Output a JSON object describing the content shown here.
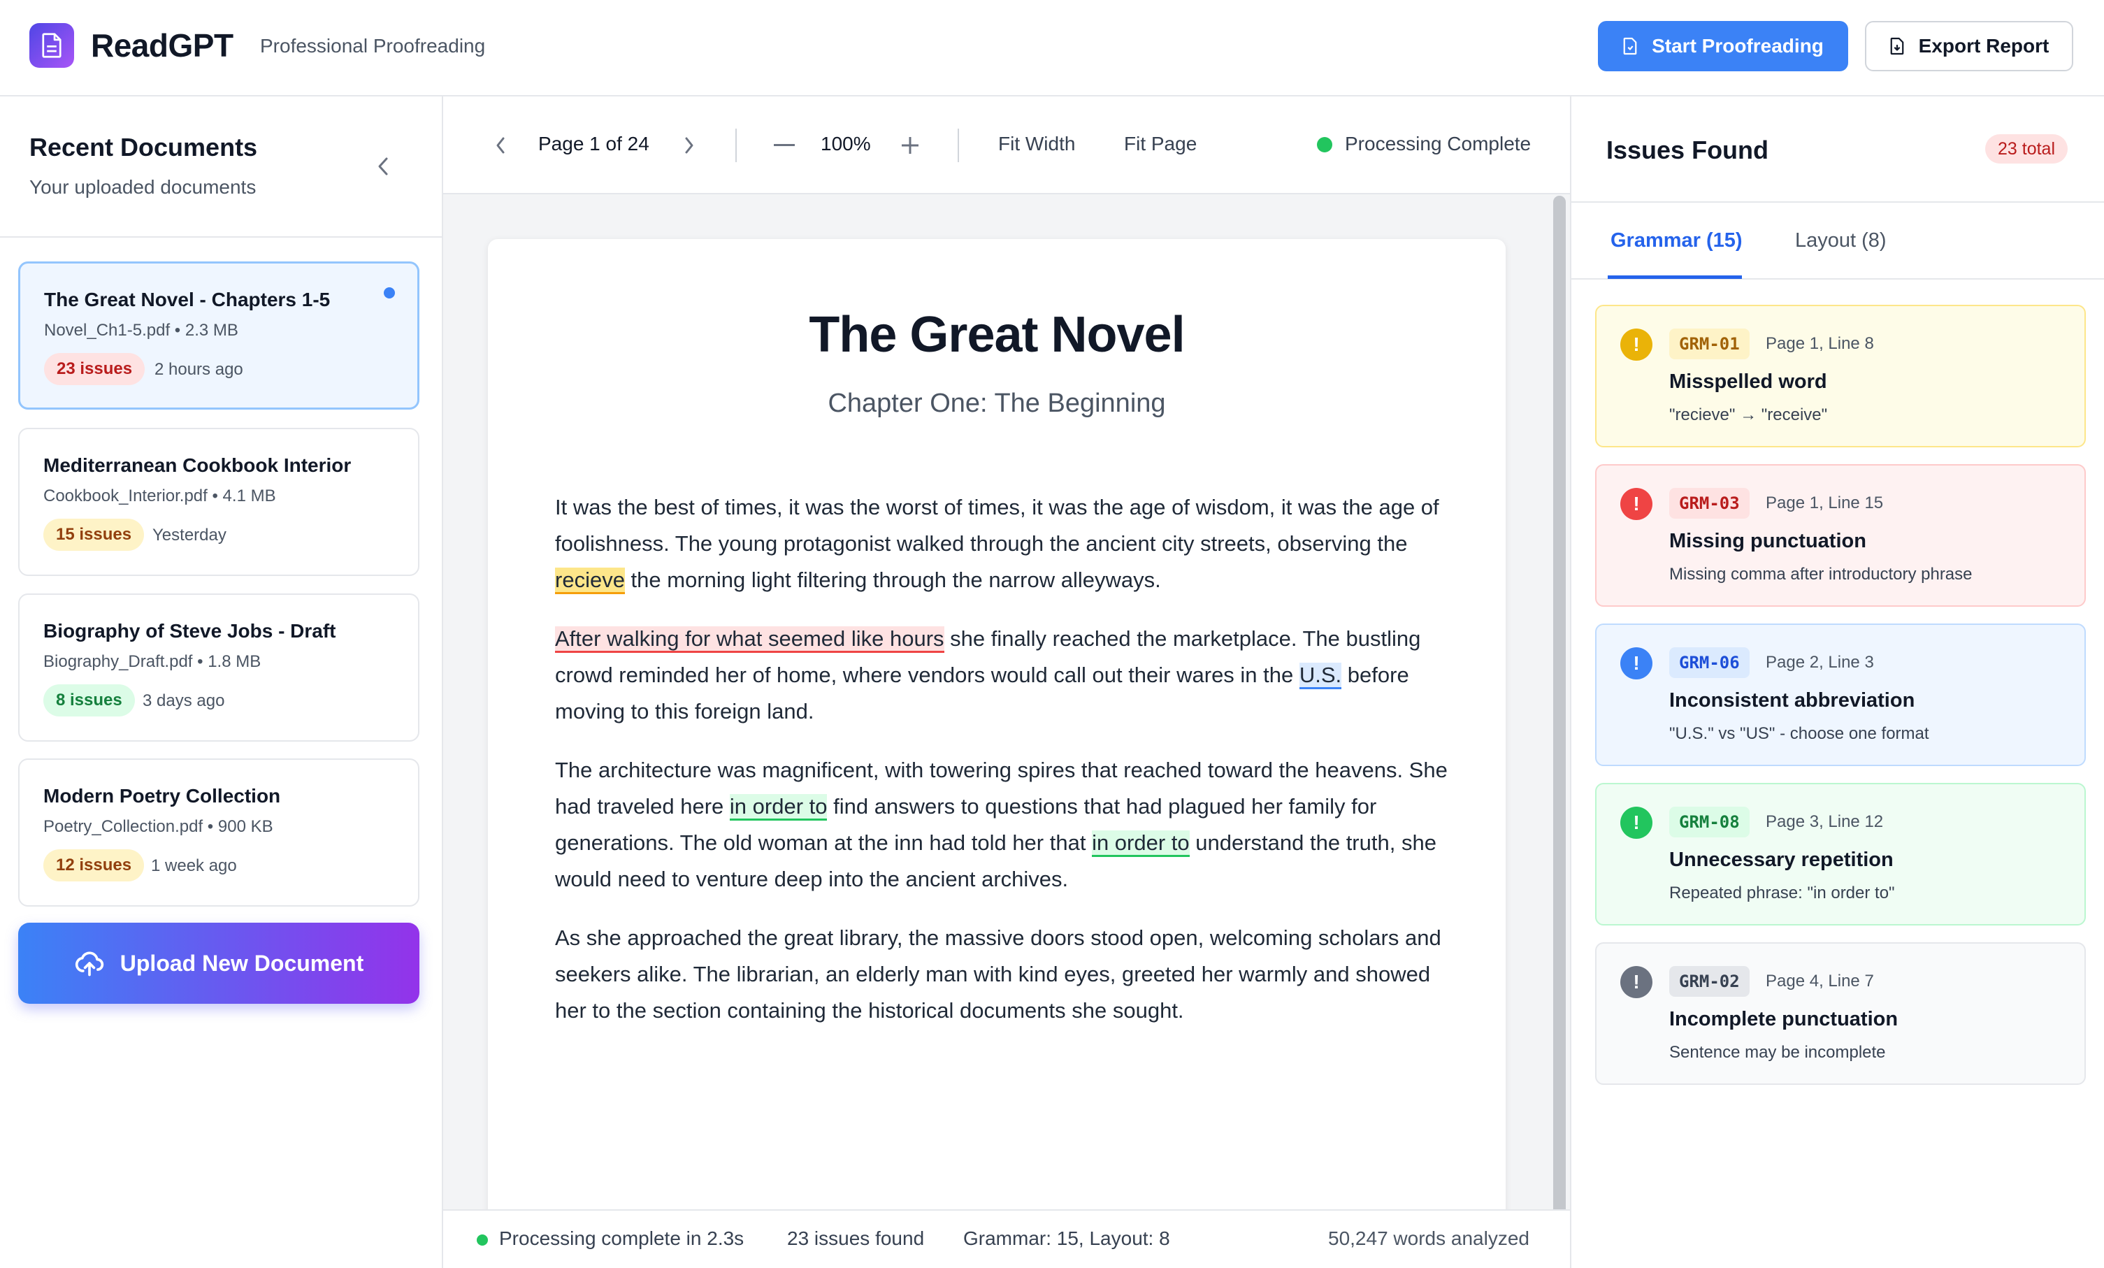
{
  "header": {
    "app_name": "ReadGPT",
    "app_subtitle": "Professional Proofreading",
    "start_button": "Start Proofreading",
    "export_button": "Export Report",
    "brand_gradient": [
      "#4f46e5",
      "#a855f7"
    ],
    "accent": "#3b82f6"
  },
  "sidebar": {
    "title": "Recent Documents",
    "subtitle": "Your uploaded documents",
    "documents": [
      {
        "title": "The Great Novel - Chapters 1-5",
        "meta": "Novel_Ch1-5.pdf • 2.3 MB",
        "issues": "23 issues",
        "time": "2 hours ago"
      },
      {
        "title": "Mediterranean Cookbook Interior",
        "meta": "Cookbook_Interior.pdf • 4.1 MB",
        "issues": "15 issues",
        "time": "Yesterday"
      },
      {
        "title": "Biography of Steve Jobs - Draft",
        "meta": "Biography_Draft.pdf • 1.8 MB",
        "issues": "8 issues",
        "time": "3 days ago"
      },
      {
        "title": "Modern Poetry Collection",
        "meta": "Poetry_Collection.pdf • 900 KB",
        "issues": "12 issues",
        "time": "1 week ago"
      }
    ],
    "upload_button": "Upload New Document"
  },
  "toolbar": {
    "page_indicator": "Page 1 of 24",
    "zoom": "100%",
    "fit_width": "Fit Width",
    "fit_page": "Fit Page",
    "status": "Processing Complete"
  },
  "document": {
    "title": "The Great Novel",
    "subtitle": "Chapter One: The Beginning",
    "p1": {
      "a": "It was the best of times, it was the worst of times, it was the age of wisdom, it was the age of foolishness. The young protagonist walked through the ancient city streets, observing the ",
      "error": "recieve",
      "b": " the morning light filtering through the narrow alleyways."
    },
    "p2": {
      "error1": "After walking for what seemed like hours",
      "a": " she finally reached the marketplace. The bustling crowd reminded her of home, where vendors would call out their wares in the ",
      "error2": "U.S.",
      "b": " before moving to this foreign land."
    },
    "p3": {
      "a": "The architecture was magnificent, with towering spires that reached toward the heavens. She had traveled here ",
      "error1": "in order to",
      "b": " find answers to questions that had plagued her family for generations. The old woman at the inn had told her that ",
      "error2": "in order to",
      "c": " understand the truth, she would need to venture deep into the ancient archives."
    },
    "p4": "As she approached the great library, the massive doors stood open, welcoming scholars and seekers alike. The librarian, an elderly man with kind eyes, greeted her warmly and showed her to the section containing the historical documents she sought."
  },
  "statusbar": {
    "processing": "Processing complete in 2.3s",
    "issues_found": "23 issues found",
    "breakdown": "Grammar: 15, Layout: 8",
    "words": "50,247 words analyzed"
  },
  "issues_panel": {
    "title": "Issues Found",
    "total": "23 total",
    "tabs": [
      "Grammar (15)",
      "Layout (8)"
    ],
    "items": [
      {
        "code": "GRM-01",
        "location": "Page 1, Line 8",
        "title": "Misspelled word",
        "desc": "\"recieve\" → \"receive\"",
        "color": "#eab308"
      },
      {
        "code": "GRM-03",
        "location": "Page 1, Line 15",
        "title": "Missing punctuation",
        "desc": "Missing comma after introductory phrase",
        "color": "#ef4444"
      },
      {
        "code": "GRM-06",
        "location": "Page 2, Line 3",
        "title": "Inconsistent abbreviation",
        "desc": "\"U.S.\" vs \"US\" - choose one format",
        "color": "#3b82f6"
      },
      {
        "code": "GRM-08",
        "location": "Page 3, Line 12",
        "title": "Unnecessary repetition",
        "desc": "Repeated phrase: \"in order to\"",
        "color": "#22c55e"
      },
      {
        "code": "GRM-02",
        "location": "Page 4, Line 7",
        "title": "Incomplete punctuation",
        "desc": "Sentence may be incomplete",
        "color": "#6b7280"
      }
    ]
  }
}
